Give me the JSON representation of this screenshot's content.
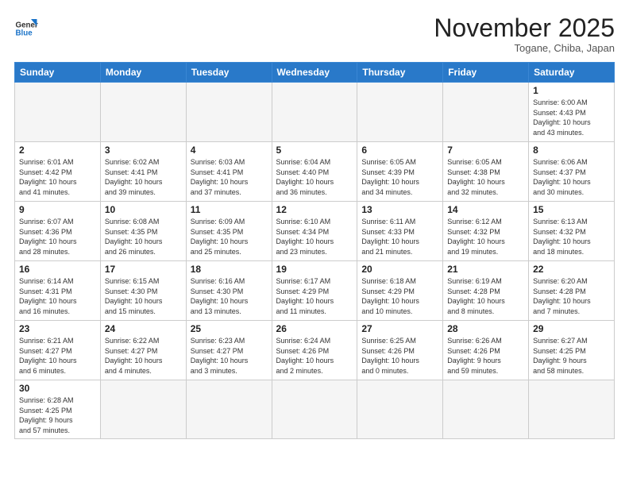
{
  "header": {
    "logo_general": "General",
    "logo_blue": "Blue",
    "month_title": "November 2025",
    "location": "Togane, Chiba, Japan"
  },
  "weekdays": [
    "Sunday",
    "Monday",
    "Tuesday",
    "Wednesday",
    "Thursday",
    "Friday",
    "Saturday"
  ],
  "weeks": [
    [
      {
        "day": "",
        "info": ""
      },
      {
        "day": "",
        "info": ""
      },
      {
        "day": "",
        "info": ""
      },
      {
        "day": "",
        "info": ""
      },
      {
        "day": "",
        "info": ""
      },
      {
        "day": "",
        "info": ""
      },
      {
        "day": "1",
        "info": "Sunrise: 6:00 AM\nSunset: 4:43 PM\nDaylight: 10 hours\nand 43 minutes."
      }
    ],
    [
      {
        "day": "2",
        "info": "Sunrise: 6:01 AM\nSunset: 4:42 PM\nDaylight: 10 hours\nand 41 minutes."
      },
      {
        "day": "3",
        "info": "Sunrise: 6:02 AM\nSunset: 4:41 PM\nDaylight: 10 hours\nand 39 minutes."
      },
      {
        "day": "4",
        "info": "Sunrise: 6:03 AM\nSunset: 4:41 PM\nDaylight: 10 hours\nand 37 minutes."
      },
      {
        "day": "5",
        "info": "Sunrise: 6:04 AM\nSunset: 4:40 PM\nDaylight: 10 hours\nand 36 minutes."
      },
      {
        "day": "6",
        "info": "Sunrise: 6:05 AM\nSunset: 4:39 PM\nDaylight: 10 hours\nand 34 minutes."
      },
      {
        "day": "7",
        "info": "Sunrise: 6:05 AM\nSunset: 4:38 PM\nDaylight: 10 hours\nand 32 minutes."
      },
      {
        "day": "8",
        "info": "Sunrise: 6:06 AM\nSunset: 4:37 PM\nDaylight: 10 hours\nand 30 minutes."
      }
    ],
    [
      {
        "day": "9",
        "info": "Sunrise: 6:07 AM\nSunset: 4:36 PM\nDaylight: 10 hours\nand 28 minutes."
      },
      {
        "day": "10",
        "info": "Sunrise: 6:08 AM\nSunset: 4:35 PM\nDaylight: 10 hours\nand 26 minutes."
      },
      {
        "day": "11",
        "info": "Sunrise: 6:09 AM\nSunset: 4:35 PM\nDaylight: 10 hours\nand 25 minutes."
      },
      {
        "day": "12",
        "info": "Sunrise: 6:10 AM\nSunset: 4:34 PM\nDaylight: 10 hours\nand 23 minutes."
      },
      {
        "day": "13",
        "info": "Sunrise: 6:11 AM\nSunset: 4:33 PM\nDaylight: 10 hours\nand 21 minutes."
      },
      {
        "day": "14",
        "info": "Sunrise: 6:12 AM\nSunset: 4:32 PM\nDaylight: 10 hours\nand 19 minutes."
      },
      {
        "day": "15",
        "info": "Sunrise: 6:13 AM\nSunset: 4:32 PM\nDaylight: 10 hours\nand 18 minutes."
      }
    ],
    [
      {
        "day": "16",
        "info": "Sunrise: 6:14 AM\nSunset: 4:31 PM\nDaylight: 10 hours\nand 16 minutes."
      },
      {
        "day": "17",
        "info": "Sunrise: 6:15 AM\nSunset: 4:30 PM\nDaylight: 10 hours\nand 15 minutes."
      },
      {
        "day": "18",
        "info": "Sunrise: 6:16 AM\nSunset: 4:30 PM\nDaylight: 10 hours\nand 13 minutes."
      },
      {
        "day": "19",
        "info": "Sunrise: 6:17 AM\nSunset: 4:29 PM\nDaylight: 10 hours\nand 11 minutes."
      },
      {
        "day": "20",
        "info": "Sunrise: 6:18 AM\nSunset: 4:29 PM\nDaylight: 10 hours\nand 10 minutes."
      },
      {
        "day": "21",
        "info": "Sunrise: 6:19 AM\nSunset: 4:28 PM\nDaylight: 10 hours\nand 8 minutes."
      },
      {
        "day": "22",
        "info": "Sunrise: 6:20 AM\nSunset: 4:28 PM\nDaylight: 10 hours\nand 7 minutes."
      }
    ],
    [
      {
        "day": "23",
        "info": "Sunrise: 6:21 AM\nSunset: 4:27 PM\nDaylight: 10 hours\nand 6 minutes."
      },
      {
        "day": "24",
        "info": "Sunrise: 6:22 AM\nSunset: 4:27 PM\nDaylight: 10 hours\nand 4 minutes."
      },
      {
        "day": "25",
        "info": "Sunrise: 6:23 AM\nSunset: 4:27 PM\nDaylight: 10 hours\nand 3 minutes."
      },
      {
        "day": "26",
        "info": "Sunrise: 6:24 AM\nSunset: 4:26 PM\nDaylight: 10 hours\nand 2 minutes."
      },
      {
        "day": "27",
        "info": "Sunrise: 6:25 AM\nSunset: 4:26 PM\nDaylight: 10 hours\nand 0 minutes."
      },
      {
        "day": "28",
        "info": "Sunrise: 6:26 AM\nSunset: 4:26 PM\nDaylight: 9 hours\nand 59 minutes."
      },
      {
        "day": "29",
        "info": "Sunrise: 6:27 AM\nSunset: 4:25 PM\nDaylight: 9 hours\nand 58 minutes."
      }
    ],
    [
      {
        "day": "30",
        "info": "Sunrise: 6:28 AM\nSunset: 4:25 PM\nDaylight: 9 hours\nand 57 minutes."
      },
      {
        "day": "",
        "info": ""
      },
      {
        "day": "",
        "info": ""
      },
      {
        "day": "",
        "info": ""
      },
      {
        "day": "",
        "info": ""
      },
      {
        "day": "",
        "info": ""
      },
      {
        "day": "",
        "info": ""
      }
    ]
  ]
}
